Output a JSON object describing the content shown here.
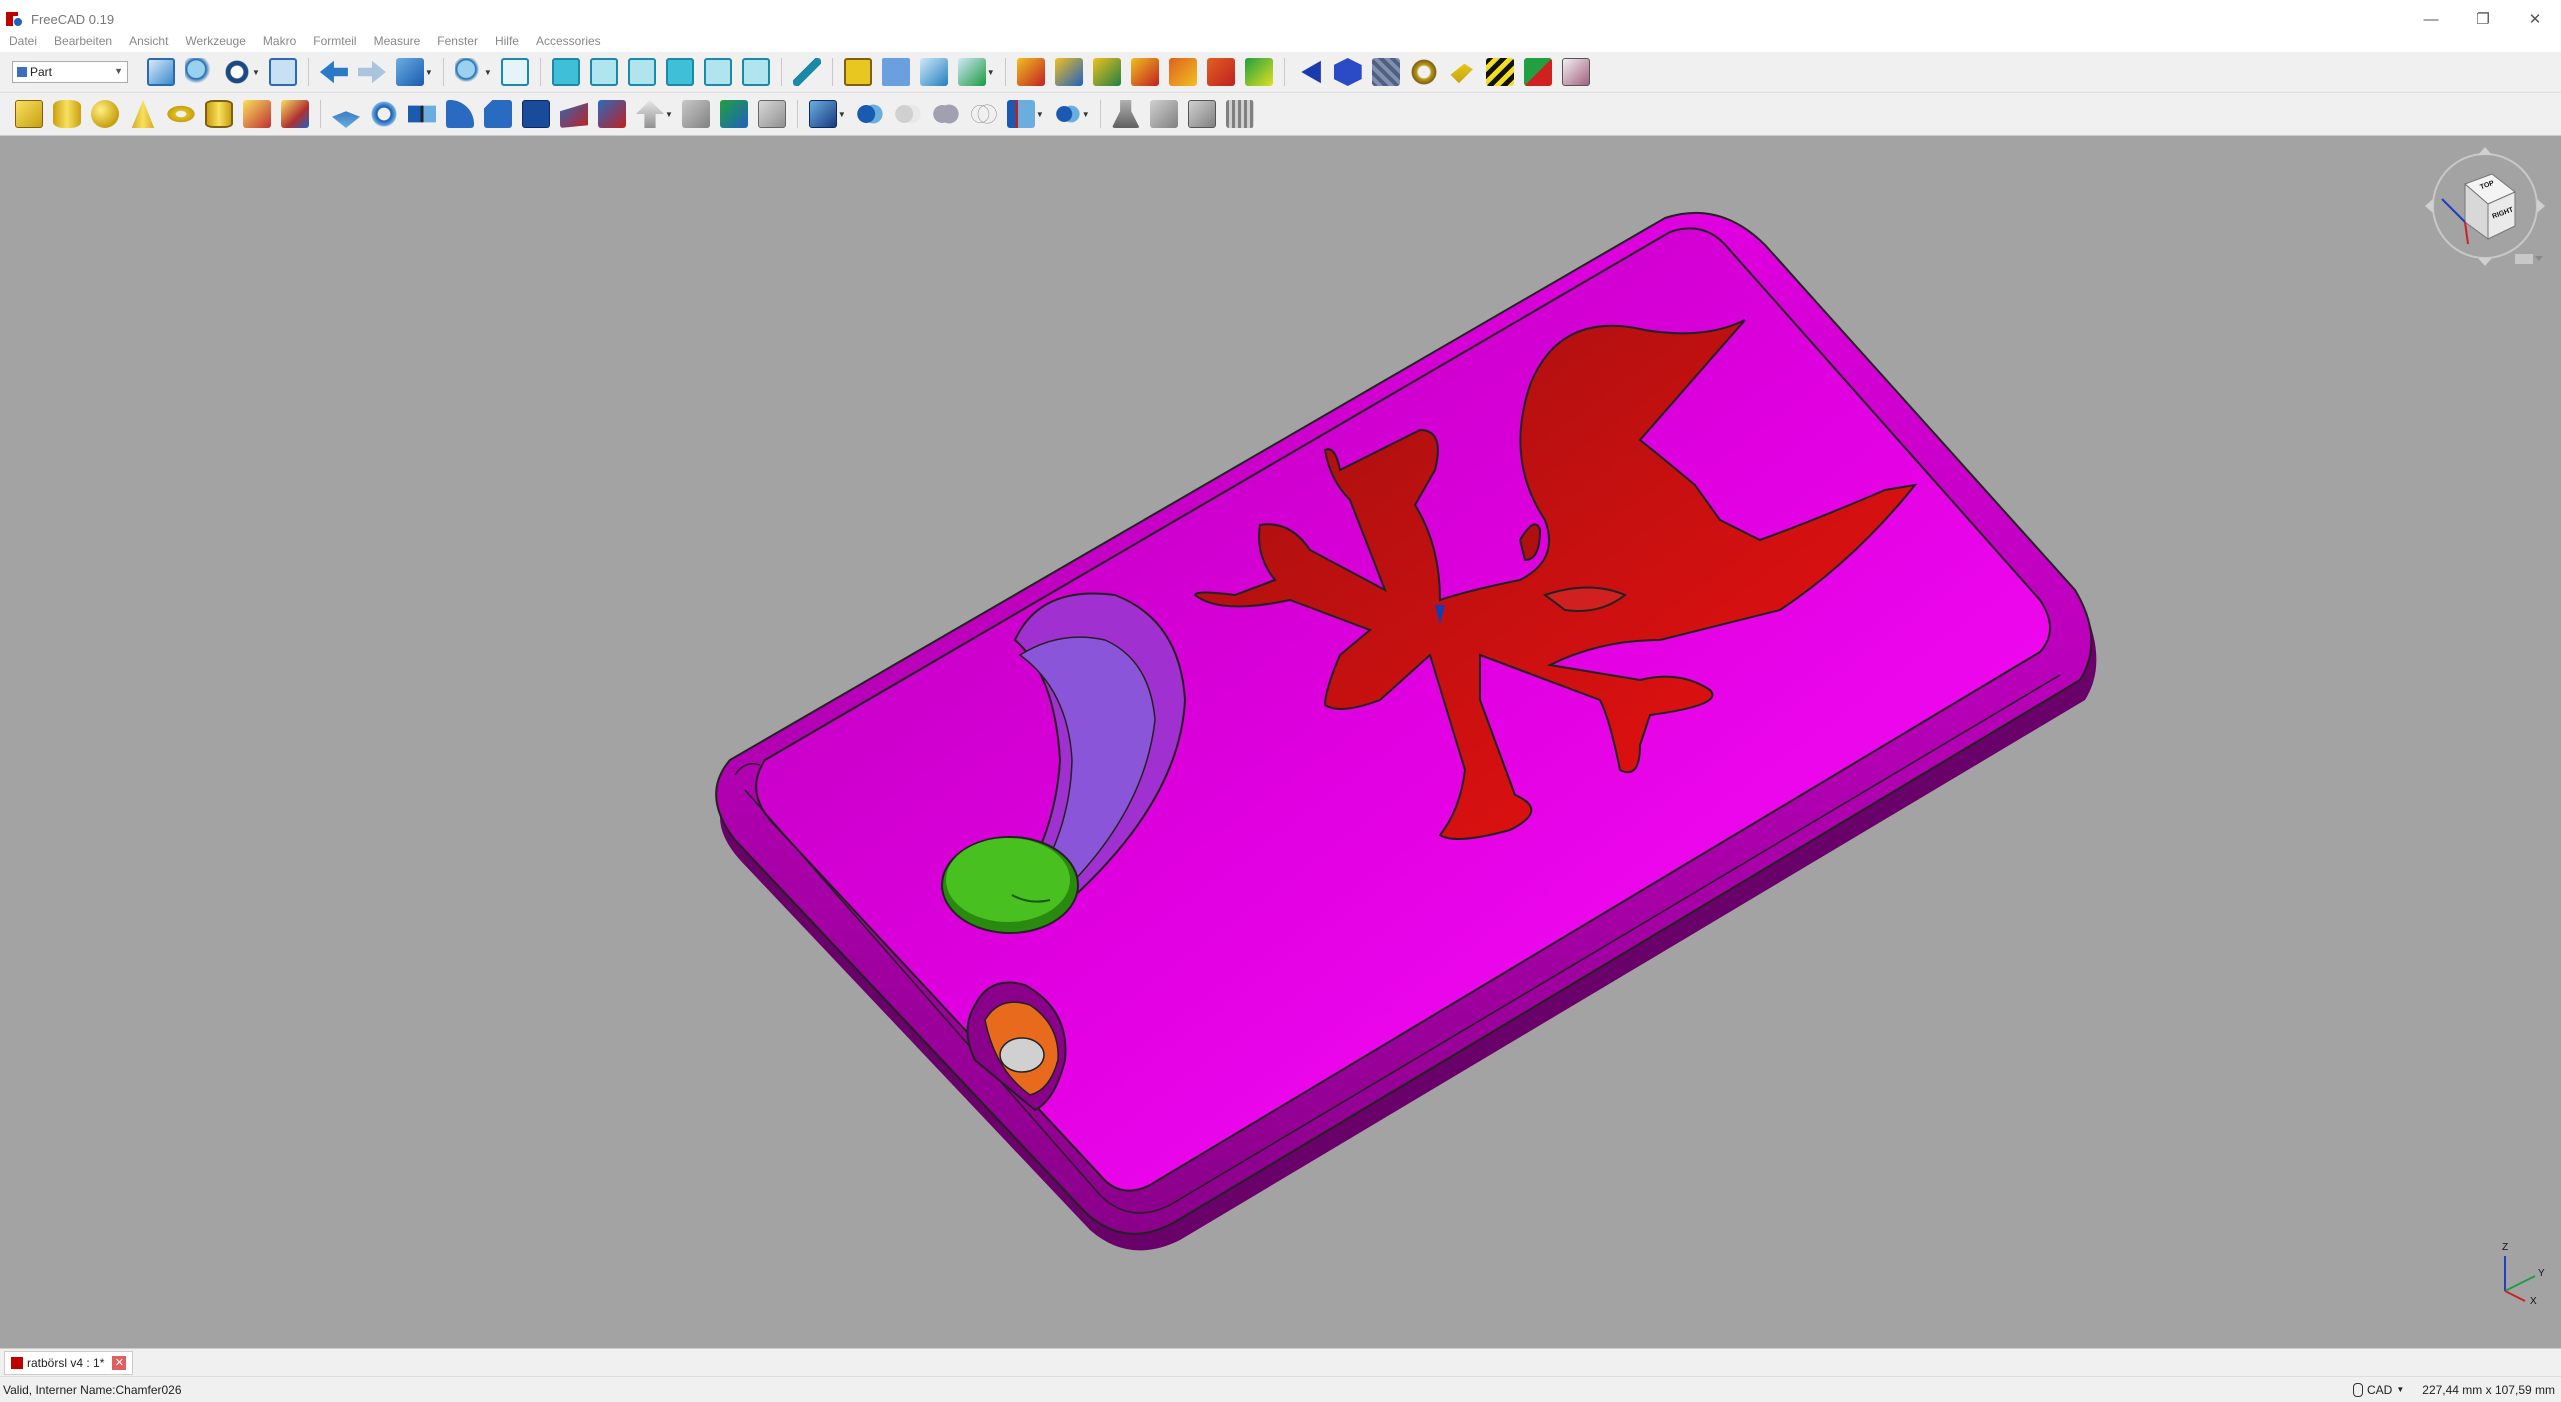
{
  "window": {
    "title": "FreeCAD 0.19",
    "controls": {
      "minimize": "—",
      "maximize": "❐",
      "close": "✕"
    }
  },
  "menubar": {
    "items": [
      "Datei",
      "Bearbeiten",
      "Ansicht",
      "Werkzeuge",
      "Makro",
      "Formteil",
      "Measure",
      "Fenster",
      "Hilfe",
      "Accessories"
    ]
  },
  "toolbar": {
    "workbench": "Part"
  },
  "navcube": {
    "top_face": "TOP",
    "right_face": "RIGHT"
  },
  "axis": {
    "x": "X",
    "y": "Y",
    "z": "Z"
  },
  "document_tab": {
    "label": "ratbörsl v4 : 1*",
    "close": "✕"
  },
  "statusbar": {
    "message": "Valid, Interner Name:Chamfer026",
    "nav_style": "CAD",
    "dimensions": "227,44 mm x 107,59 mm"
  },
  "colors": {
    "body": "#ee00ee",
    "emblem": "#d41010",
    "slot": "#8a4fd8",
    "button": "#3fb81a",
    "ring": "#e86a1c",
    "background": "#a3a3a3"
  }
}
